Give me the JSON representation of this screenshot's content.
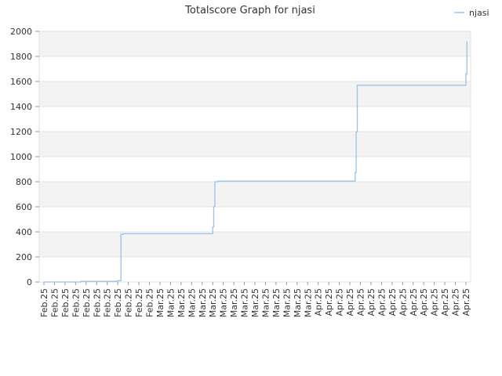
{
  "chart_data": {
    "type": "line",
    "title": "Totalscore Graph for njasi",
    "xlabel": "",
    "ylabel": "",
    "ylim": [
      0,
      2000
    ],
    "yticks": [
      0,
      200,
      400,
      600,
      800,
      1000,
      1200,
      1400,
      1600,
      1800,
      2000
    ],
    "grid": true,
    "legend_position": "top-right",
    "x_tick_labels": [
      "Feb.25",
      "Feb.25",
      "Feb.25",
      "Feb.25",
      "Feb.25",
      "Feb.25",
      "Feb.25",
      "Feb.25",
      "Feb.25",
      "Feb.25",
      "Feb.25",
      "Mar.25",
      "Mar.25",
      "Mar.25",
      "Mar.25",
      "Mar.25",
      "Mar.25",
      "Mar.25",
      "Mar.25",
      "Mar.25",
      "Mar.25",
      "Mar.25",
      "Mar.25",
      "Mar.25",
      "Mar.25",
      "Mar.25",
      "Apr.25",
      "Apr.25",
      "Apr.25",
      "Apr.25",
      "Apr.25",
      "Apr.25",
      "Apr.25",
      "Apr.25",
      "Apr.25",
      "Apr.25",
      "Apr.25",
      "Apr.25",
      "Apr.25",
      "Apr.25",
      "Apr.25"
    ],
    "series": [
      {
        "name": "njasi",
        "color": "#99c2ea",
        "step": true,
        "points": [
          [
            0,
            0
          ],
          [
            3.5,
            5
          ],
          [
            7,
            10
          ],
          [
            7.3,
            380
          ],
          [
            7.5,
            385
          ],
          [
            16,
            440
          ],
          [
            16.1,
            600
          ],
          [
            16.2,
            800
          ],
          [
            16.5,
            805
          ],
          [
            29.5,
            875
          ],
          [
            29.6,
            1200
          ],
          [
            29.7,
            1570
          ],
          [
            40,
            1660
          ],
          [
            40.1,
            1920
          ]
        ]
      }
    ]
  }
}
